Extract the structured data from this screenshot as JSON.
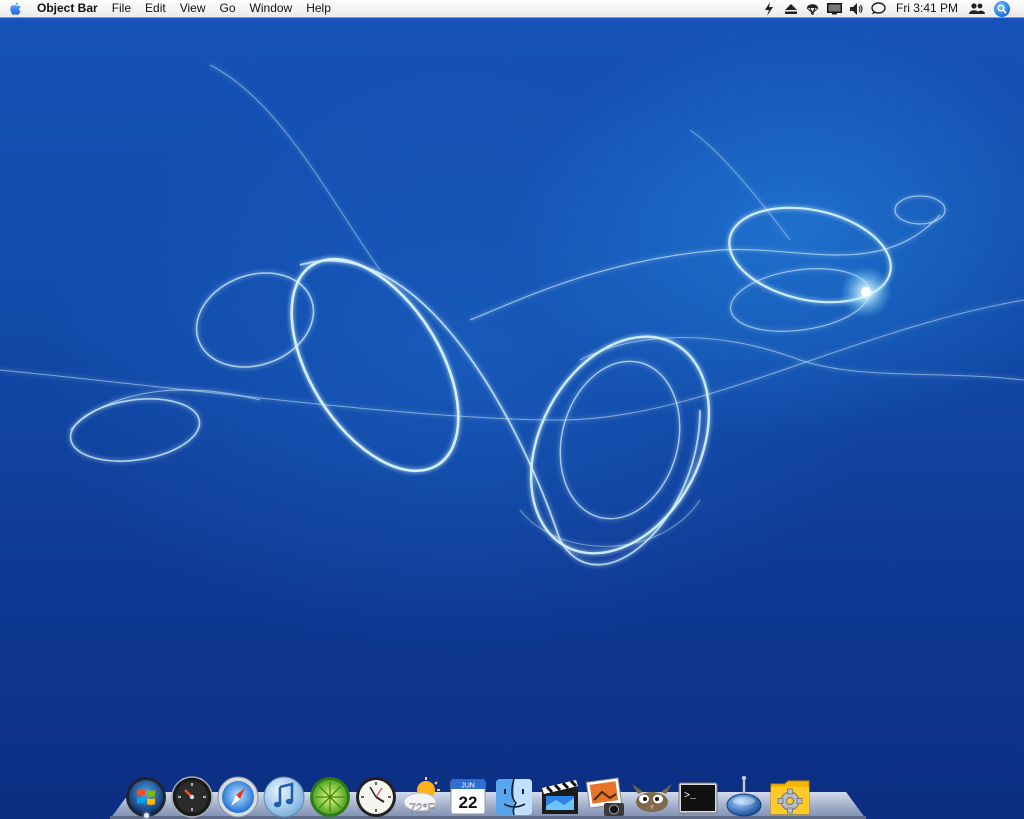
{
  "menubar": {
    "apple_icon": "apple-logo-icon",
    "app_name": "Object Bar",
    "menus": [
      "File",
      "Edit",
      "View",
      "Go",
      "Window",
      "Help"
    ],
    "status_icons": [
      "script-icon",
      "eject-icon",
      "parachute-icon",
      "display-icon",
      "volume-icon",
      "chat-icon"
    ],
    "clock": "Fri 3:41 PM",
    "user_icon": "users-icon",
    "spotlight_icon": "spotlight-search-icon"
  },
  "dock": {
    "items": [
      {
        "name": "windows-start",
        "icon": "windows-orb-icon"
      },
      {
        "name": "dashboard",
        "icon": "dashboard-gauge-icon"
      },
      {
        "name": "safari",
        "icon": "safari-compass-icon"
      },
      {
        "name": "itunes",
        "icon": "itunes-note-icon"
      },
      {
        "name": "limewire",
        "icon": "limewire-icon"
      },
      {
        "name": "clock",
        "icon": "clock-icon"
      },
      {
        "name": "weather",
        "icon": "weather-icon",
        "label": "72°F"
      },
      {
        "name": "ical",
        "icon": "calendar-icon",
        "month": "JUN",
        "day": "22"
      },
      {
        "name": "finder",
        "icon": "finder-face-icon"
      },
      {
        "name": "imovie",
        "icon": "clapperboard-icon"
      },
      {
        "name": "iphoto",
        "icon": "photo-camera-icon"
      },
      {
        "name": "gimp",
        "icon": "gimp-wilber-icon"
      },
      {
        "name": "terminal",
        "icon": "terminal-icon",
        "label": ">_"
      },
      {
        "name": "network",
        "icon": "network-globe-icon"
      },
      {
        "name": "system-preferences",
        "icon": "gear-folder-icon"
      }
    ]
  },
  "colors": {
    "desktop_top": "#1653b8",
    "desktop_bottom": "#0c2e82",
    "swirl": "#d8f6ff"
  }
}
